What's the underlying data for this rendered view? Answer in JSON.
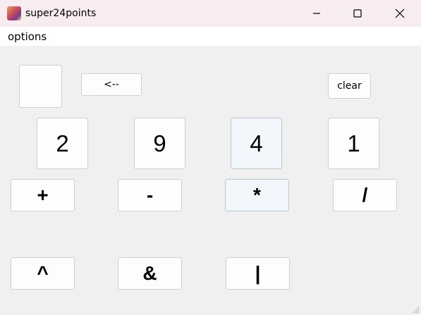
{
  "window": {
    "title": "super24points",
    "icon": "app-icon"
  },
  "menu": {
    "items": [
      {
        "label": "options"
      }
    ]
  },
  "toolbar": {
    "backspace_label": "<--",
    "clear_label": "clear"
  },
  "display": {
    "value": ""
  },
  "cards": [
    {
      "value": "2"
    },
    {
      "value": "9"
    },
    {
      "value": "4",
      "highlighted": true
    },
    {
      "value": "1"
    }
  ],
  "operators": [
    {
      "symbol": "+"
    },
    {
      "symbol": "-"
    },
    {
      "symbol": "*",
      "highlighted": true
    },
    {
      "symbol": "/"
    },
    {
      "symbol": "^"
    },
    {
      "symbol": "&"
    },
    {
      "symbol": "|"
    }
  ]
}
